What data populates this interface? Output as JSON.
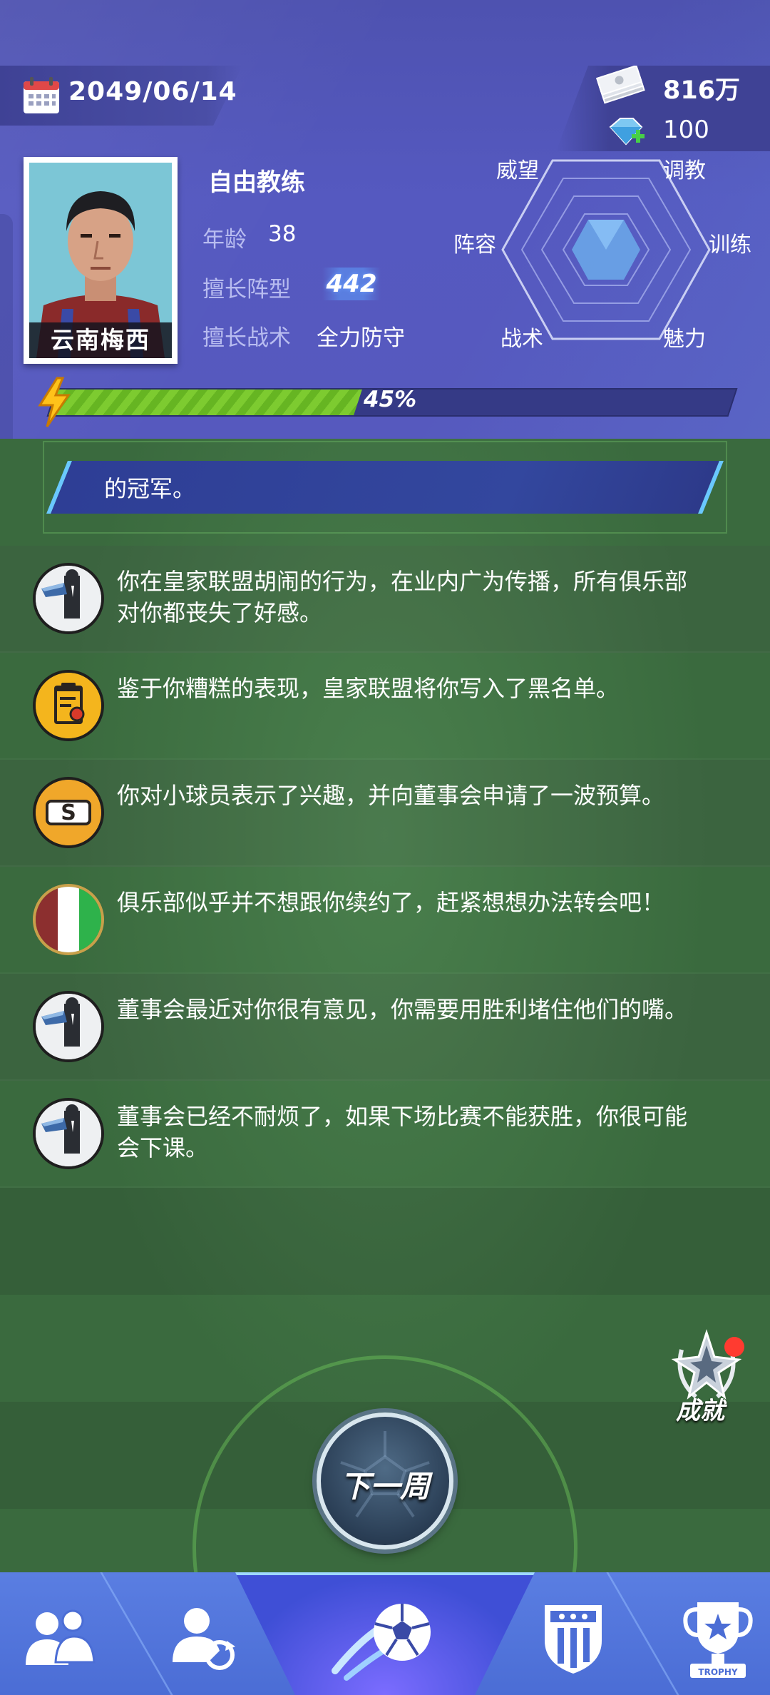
{
  "header": {
    "date": "2049/06/14",
    "cash": "816万",
    "gems": "100",
    "coach_title": "自由教练",
    "portrait_name": "云南梅西",
    "age_label": "年龄",
    "age_value": "38",
    "formation_label": "擅长阵型",
    "formation_value": "442",
    "tactic_label": "擅长战术",
    "tactic_value": "全力防守",
    "radar_labels": [
      "威望",
      "调教",
      "训练",
      "魅力",
      "战术",
      "阵容"
    ],
    "progress_percent": 45,
    "progress_text": "45%"
  },
  "banner": {
    "text": "的冠军。"
  },
  "news": [
    {
      "icon": "manager-icon",
      "text": "你在皇家联盟胡闹的行为，在业内广为传播，所有俱乐部对你都丧失了好感。"
    },
    {
      "icon": "clipboard-icon",
      "text": "鉴于你糟糕的表现，皇家联盟将你写入了黑名单。"
    },
    {
      "icon": "dollar-icon",
      "text": "你对小球员表示了兴趣，并向董事会申请了一波预算。"
    },
    {
      "icon": "italy-flag-icon",
      "text": "俱乐部似乎并不想跟你续约了，赶紧想想办法转会吧！"
    },
    {
      "icon": "manager-icon",
      "text": "董事会最近对你很有意见，你需要用胜利堵住他们的嘴。"
    },
    {
      "icon": "manager-icon",
      "text": "董事会已经不耐烦了，如果下场比赛不能获胜，你很可能会下课。"
    }
  ],
  "achievement_label": "成就",
  "next_week_label": "下一周",
  "nav": {
    "items": [
      "team-icon",
      "transfer-icon",
      "match-icon",
      "club-icon",
      "trophy-icon"
    ],
    "trophy_text": "TROPHY"
  }
}
